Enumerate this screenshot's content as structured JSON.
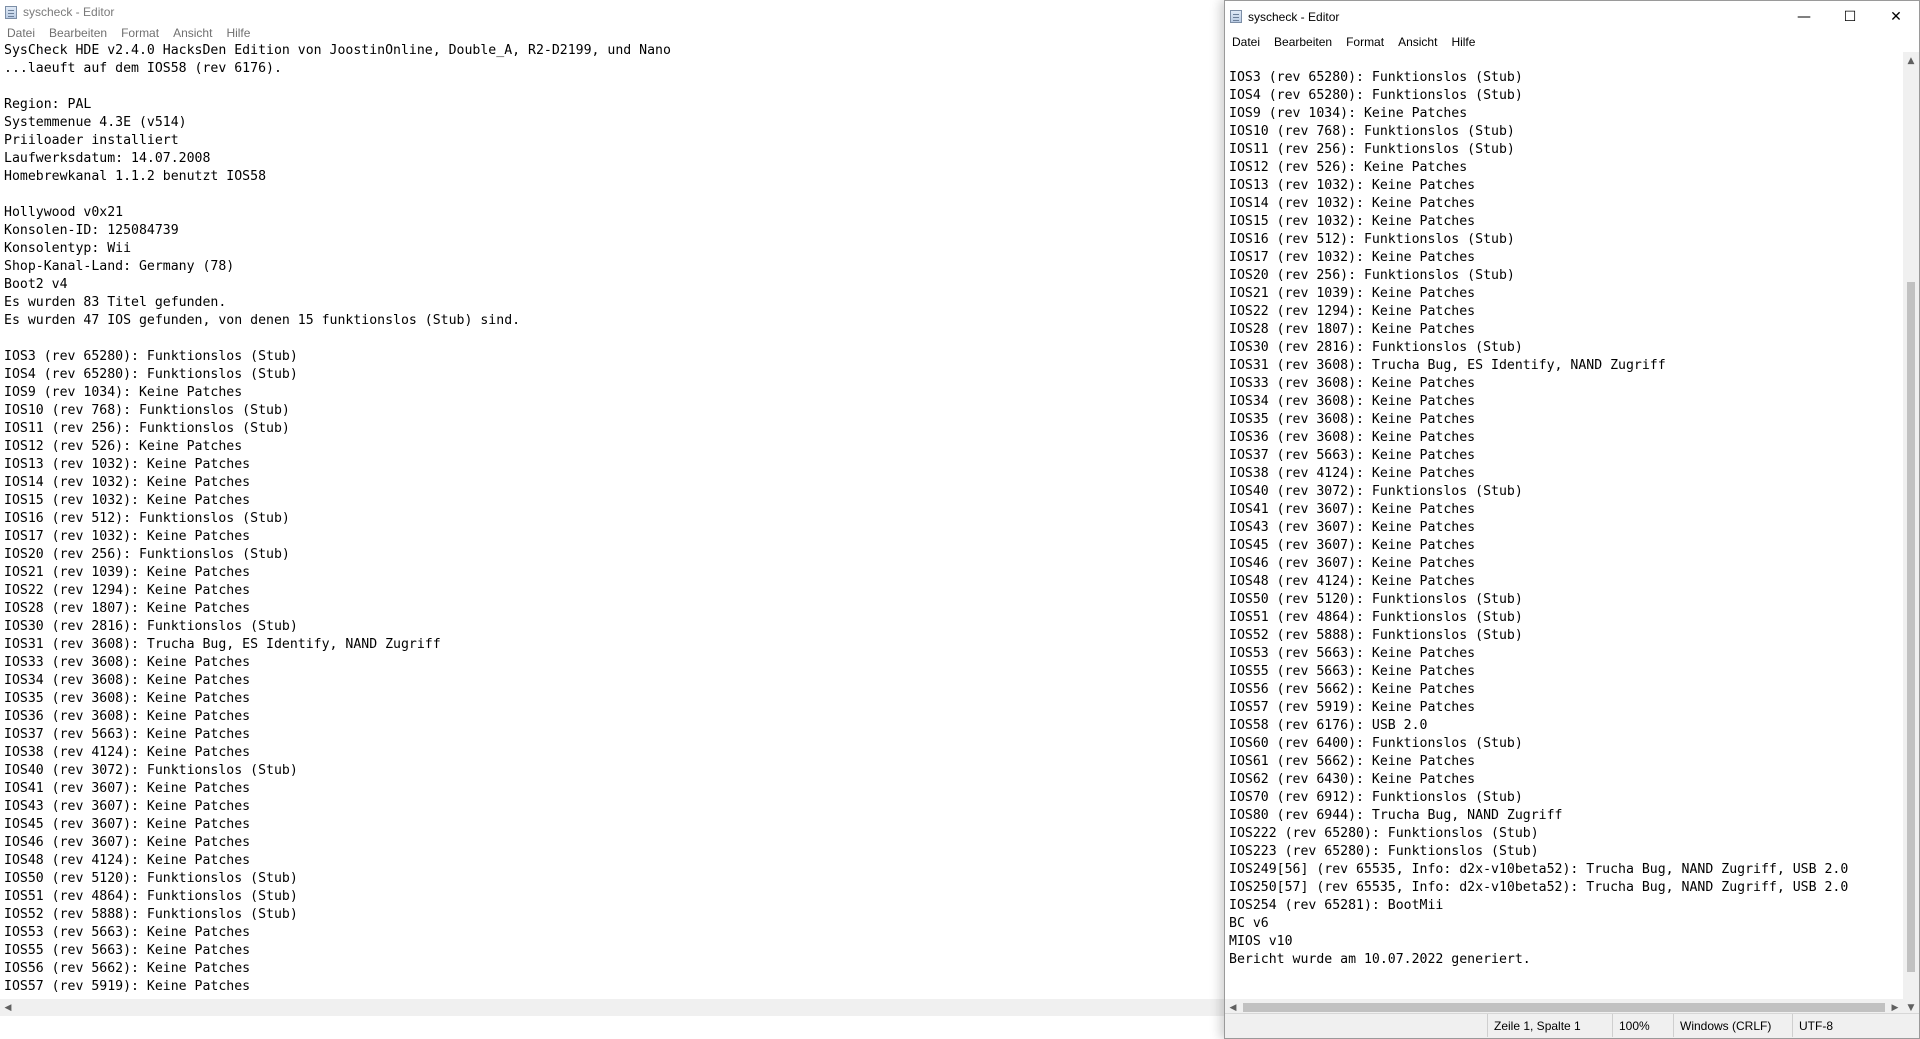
{
  "window1": {
    "title": "syscheck - Editor",
    "menu": [
      "Datei",
      "Bearbeiten",
      "Format",
      "Ansicht",
      "Hilfe"
    ],
    "lines": [
      "SysCheck HDE v2.4.0 HacksDen Edition von JoostinOnline, Double_A, R2-D2199, und Nano",
      "...laeuft auf dem IOS58 (rev 6176).",
      "",
      "Region: PAL",
      "Systemmenue 4.3E (v514)",
      "Priiloader installiert",
      "Laufwerksdatum: 14.07.2008",
      "Homebrewkanal 1.1.2 benutzt IOS58",
      "",
      "Hollywood v0x21",
      "Konsolen-ID: 125084739",
      "Konsolentyp: Wii",
      "Shop-Kanal-Land: Germany (78)",
      "Boot2 v4",
      "Es wurden 83 Titel gefunden.",
      "Es wurden 47 IOS gefunden, von denen 15 funktionslos (Stub) sind.",
      "",
      "IOS3 (rev 65280): Funktionslos (Stub)",
      "IOS4 (rev 65280): Funktionslos (Stub)",
      "IOS9 (rev 1034): Keine Patches",
      "IOS10 (rev 768): Funktionslos (Stub)",
      "IOS11 (rev 256): Funktionslos (Stub)",
      "IOS12 (rev 526): Keine Patches",
      "IOS13 (rev 1032): Keine Patches",
      "IOS14 (rev 1032): Keine Patches",
      "IOS15 (rev 1032): Keine Patches",
      "IOS16 (rev 512): Funktionslos (Stub)",
      "IOS17 (rev 1032): Keine Patches",
      "IOS20 (rev 256): Funktionslos (Stub)",
      "IOS21 (rev 1039): Keine Patches",
      "IOS22 (rev 1294): Keine Patches",
      "IOS28 (rev 1807): Keine Patches",
      "IOS30 (rev 2816): Funktionslos (Stub)",
      "IOS31 (rev 3608): Trucha Bug, ES Identify, NAND Zugriff",
      "IOS33 (rev 3608): Keine Patches",
      "IOS34 (rev 3608): Keine Patches",
      "IOS35 (rev 3608): Keine Patches",
      "IOS36 (rev 3608): Keine Patches",
      "IOS37 (rev 5663): Keine Patches",
      "IOS38 (rev 4124): Keine Patches",
      "IOS40 (rev 3072): Funktionslos (Stub)",
      "IOS41 (rev 3607): Keine Patches",
      "IOS43 (rev 3607): Keine Patches",
      "IOS45 (rev 3607): Keine Patches",
      "IOS46 (rev 3607): Keine Patches",
      "IOS48 (rev 4124): Keine Patches",
      "IOS50 (rev 5120): Funktionslos (Stub)",
      "IOS51 (rev 4864): Funktionslos (Stub)",
      "IOS52 (rev 5888): Funktionslos (Stub)",
      "IOS53 (rev 5663): Keine Patches",
      "IOS55 (rev 5663): Keine Patches",
      "IOS56 (rev 5662): Keine Patches",
      "IOS57 (rev 5919): Keine Patches"
    ]
  },
  "window2": {
    "title": "syscheck - Editor",
    "menu": [
      "Datei",
      "Bearbeiten",
      "Format",
      "Ansicht",
      "Hilfe"
    ],
    "buttons": {
      "minimize": "—",
      "maximize": "☐",
      "close": "✕"
    },
    "lines": [
      "IOS3 (rev 65280): Funktionslos (Stub)",
      "IOS4 (rev 65280): Funktionslos (Stub)",
      "IOS9 (rev 1034): Keine Patches",
      "IOS10 (rev 768): Funktionslos (Stub)",
      "IOS11 (rev 256): Funktionslos (Stub)",
      "IOS12 (rev 526): Keine Patches",
      "IOS13 (rev 1032): Keine Patches",
      "IOS14 (rev 1032): Keine Patches",
      "IOS15 (rev 1032): Keine Patches",
      "IOS16 (rev 512): Funktionslos (Stub)",
      "IOS17 (rev 1032): Keine Patches",
      "IOS20 (rev 256): Funktionslos (Stub)",
      "IOS21 (rev 1039): Keine Patches",
      "IOS22 (rev 1294): Keine Patches",
      "IOS28 (rev 1807): Keine Patches",
      "IOS30 (rev 2816): Funktionslos (Stub)",
      "IOS31 (rev 3608): Trucha Bug, ES Identify, NAND Zugriff",
      "IOS33 (rev 3608): Keine Patches",
      "IOS34 (rev 3608): Keine Patches",
      "IOS35 (rev 3608): Keine Patches",
      "IOS36 (rev 3608): Keine Patches",
      "IOS37 (rev 5663): Keine Patches",
      "IOS38 (rev 4124): Keine Patches",
      "IOS40 (rev 3072): Funktionslos (Stub)",
      "IOS41 (rev 3607): Keine Patches",
      "IOS43 (rev 3607): Keine Patches",
      "IOS45 (rev 3607): Keine Patches",
      "IOS46 (rev 3607): Keine Patches",
      "IOS48 (rev 4124): Keine Patches",
      "IOS50 (rev 5120): Funktionslos (Stub)",
      "IOS51 (rev 4864): Funktionslos (Stub)",
      "IOS52 (rev 5888): Funktionslos (Stub)",
      "IOS53 (rev 5663): Keine Patches",
      "IOS55 (rev 5663): Keine Patches",
      "IOS56 (rev 5662): Keine Patches",
      "IOS57 (rev 5919): Keine Patches",
      "IOS58 (rev 6176): USB 2.0",
      "IOS60 (rev 6400): Funktionslos (Stub)",
      "IOS61 (rev 5662): Keine Patches",
      "IOS62 (rev 6430): Keine Patches",
      "IOS70 (rev 6912): Funktionslos (Stub)",
      "IOS80 (rev 6944): Trucha Bug, NAND Zugriff",
      "IOS222 (rev 65280): Funktionslos (Stub)",
      "IOS223 (rev 65280): Funktionslos (Stub)",
      "IOS249[56] (rev 65535, Info: d2x-v10beta52): Trucha Bug, NAND Zugriff, USB 2.0",
      "IOS250[57] (rev 65535, Info: d2x-v10beta52): Trucha Bug, NAND Zugriff, USB 2.0",
      "IOS254 (rev 65281): BootMii",
      "BC v6",
      "MIOS v10",
      "Bericht wurde am 10.07.2022 generiert."
    ],
    "status": {
      "position": "Zeile 1, Spalte 1",
      "zoom": "100%",
      "line_ending": "Windows (CRLF)",
      "encoding": "UTF-8"
    }
  },
  "colors": {
    "accent": "#0078d4",
    "scroll_track": "#f0f0f0",
    "scroll_thumb": "#c1c1c1"
  },
  "icons": {
    "app": "notepad-icon",
    "scroll_left": "◀",
    "scroll_right": "▶",
    "scroll_up": "▲",
    "scroll_down": "▼"
  }
}
